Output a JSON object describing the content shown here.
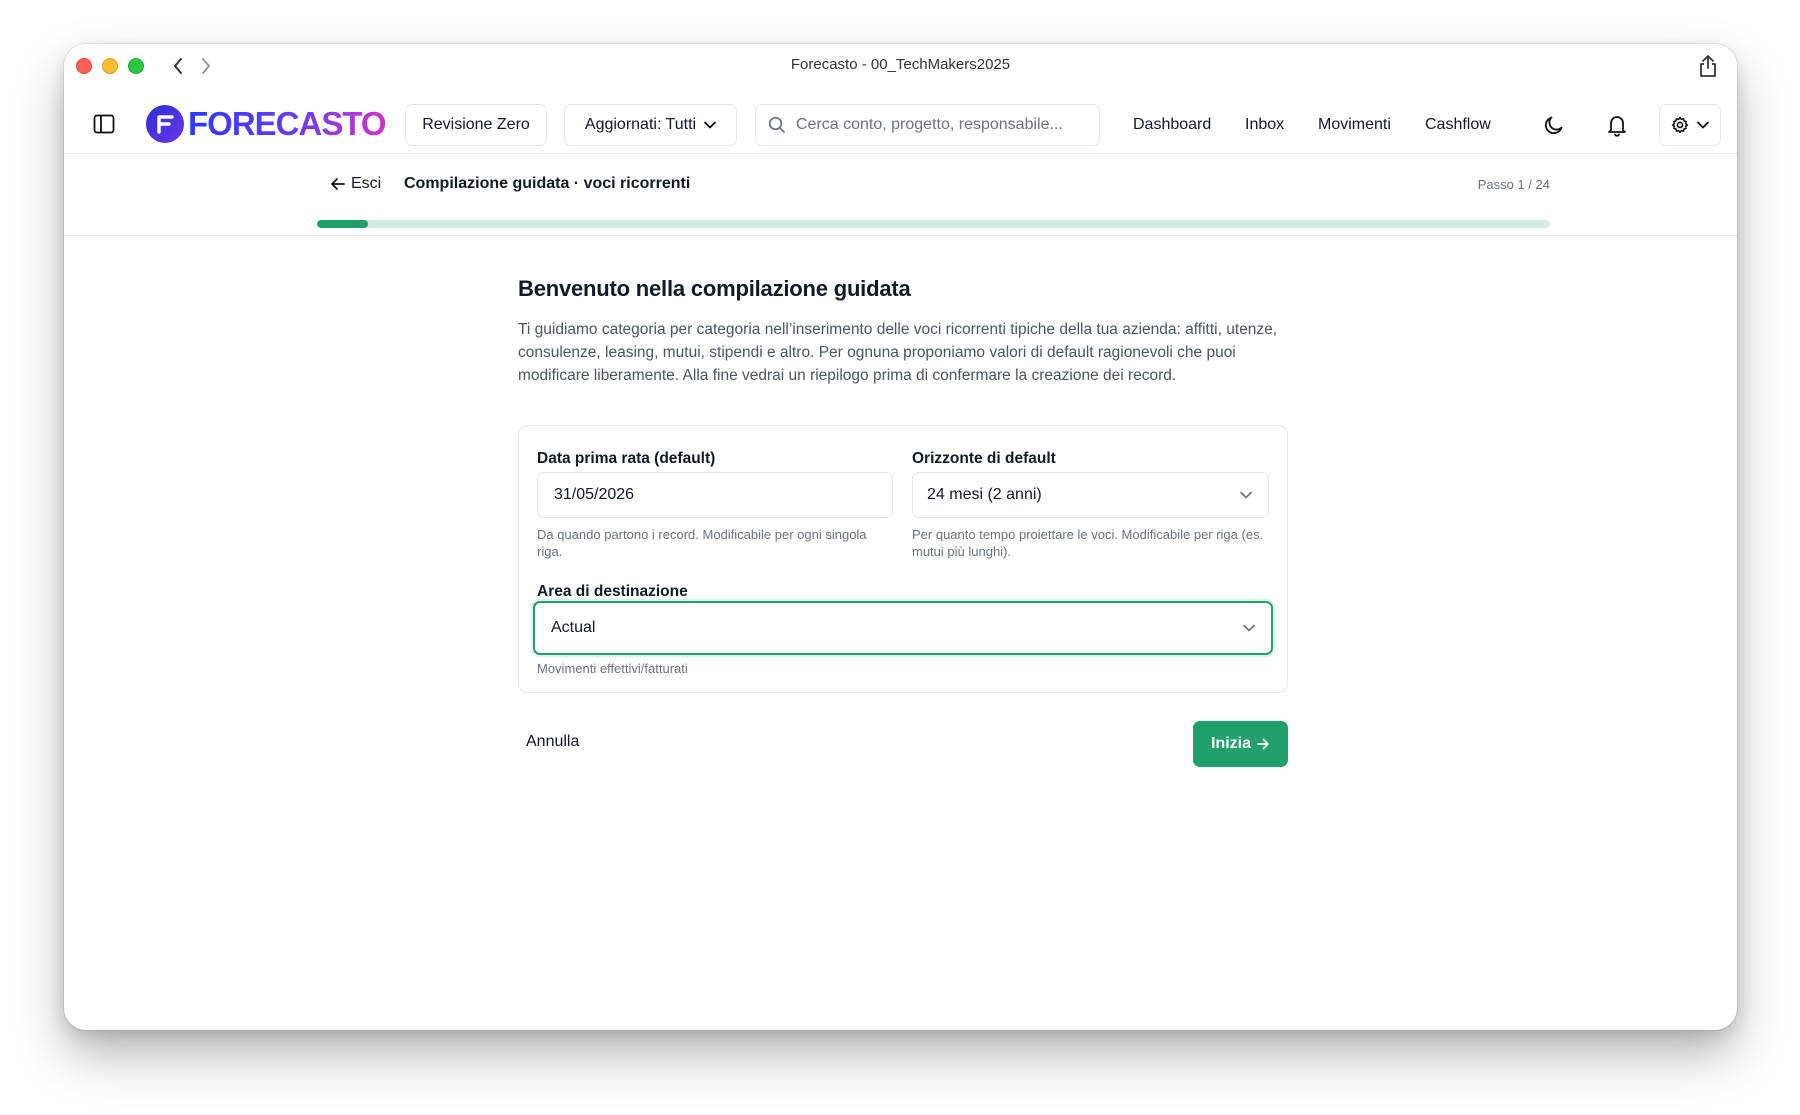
{
  "window": {
    "title": "Forecasto - 00_TechMakers2025"
  },
  "header": {
    "logo_text": "FORECASTO",
    "revisione_label": "Revisione Zero",
    "aggiornati_label": "Aggiornati: Tutti",
    "search_placeholder": "Cerca conto, progetto, responsabile...",
    "nav": {
      "dashboard": "Dashboard",
      "inbox": "Inbox",
      "movimenti": "Movimenti",
      "cashflow": "Cashflow"
    },
    "icons": [
      "sidebar-toggle-icon",
      "moon-icon",
      "bell-icon",
      "gear-icon",
      "chevron-down-icon"
    ]
  },
  "wizard": {
    "back_label": "Esci",
    "title": "Compilazione guidata · voci ricorrenti",
    "step_label": "Passo 1 / 24",
    "progress_fraction": 0.0417
  },
  "main": {
    "title": "Benvenuto nella compilazione guidata",
    "intro": "Ti guidiamo categoria per categoria nell’inserimento delle voci ricorrenti tipiche della tua azienda: affitti, utenze, consulenze, leasing, mutui, stipendi e altro. Per ognuna proponiamo valori di default ragionevoli che puoi modificare liberamente. Alla fine vedrai un riepilogo prima di confermare la creazione dei record.",
    "fields": {
      "data_prima_rata": {
        "label": "Data prima rata (default)",
        "value": "31/05/2026",
        "help": "Da quando partono i record. Modificabile per ogni singola riga."
      },
      "orizzonte": {
        "label": "Orizzonte di default",
        "value": "24 mesi (2 anni)",
        "help": "Per quanto tempo proiettare le voci. Modificabile per riga (es. mutui più lunghi)."
      },
      "area": {
        "label": "Area di destinazione",
        "value": "Actual",
        "help": "Movimenti effettivi/fatturati"
      }
    },
    "cancel_label": "Annulla",
    "start_label": "Inizia"
  },
  "colors": {
    "accent": "#22a06b",
    "progress_track": "#d6ece3",
    "logo_gradient": [
      "#2b3bff",
      "#6a3df0",
      "#d62fd1"
    ]
  }
}
